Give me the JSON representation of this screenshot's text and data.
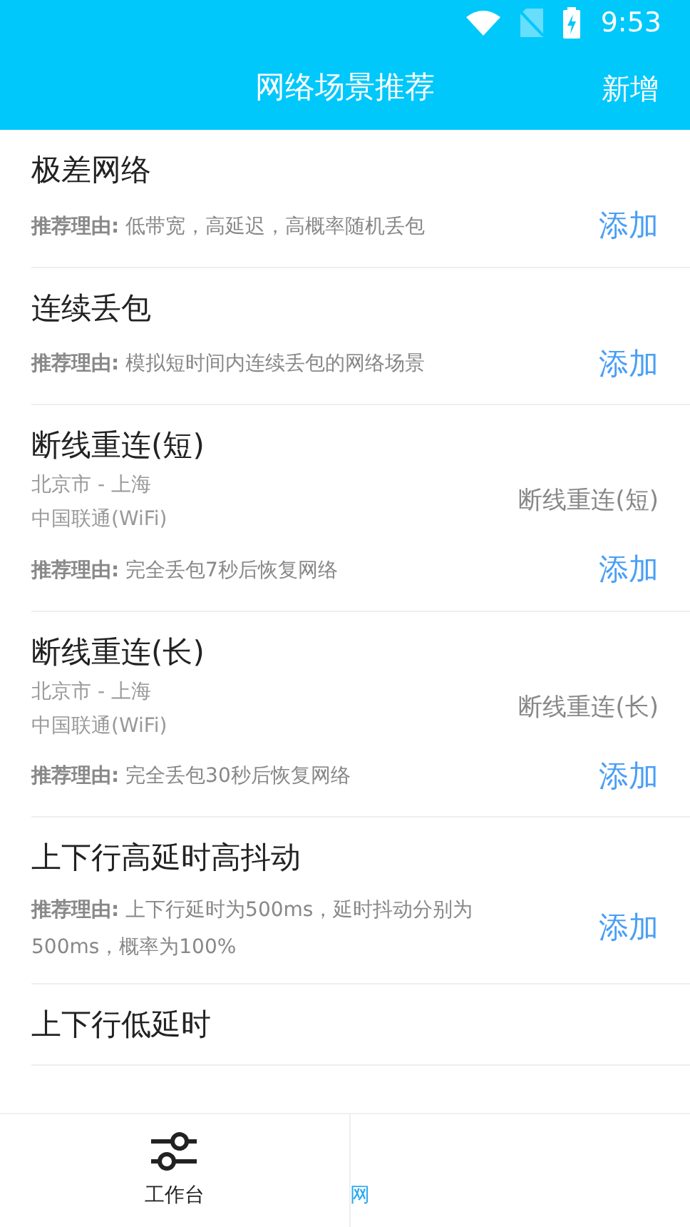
{
  "status_bar": {
    "time": "9:53"
  },
  "header": {
    "title": "网络场景推荐",
    "action": "新增"
  },
  "scenes": [
    {
      "title": "极差网络",
      "reason": "**推荐理由:** 低带宽，高延迟，高概率随机丢包",
      "action": "添加"
    },
    {
      "title": "连续丢包",
      "reason": "**推荐理由:** 模拟短时间内连续丢包的网络场景",
      "action": "添加"
    },
    {
      "title": "断线重连(短)",
      "route": "北京市 - 上海",
      "carrier": "中国联通(WiFi)",
      "tag": "断线重连(短)",
      "reason": "**推荐理由:** 完全丢包7秒后恢复网络",
      "action": "添加"
    },
    {
      "title": "断线重连(长)",
      "route": "北京市 - 上海",
      "carrier": "中国联通(WiFi)",
      "tag": "断线重连(长)",
      "reason": "**推荐理由:** 完全丢包30秒后恢复网络",
      "action": "添加"
    },
    {
      "title": "上下行高延时高抖动",
      "reason": "**推荐理由:** 上下行延时为500ms，延时抖动分别为500ms，概率为100%",
      "action": "添加"
    },
    {
      "title": "上下行低延时"
    }
  ],
  "bottom_nav": [
    {
      "kind": "workbench",
      "label": "工作台",
      "selected": false
    },
    {
      "kind": "network",
      "label": "网",
      "selected": true
    }
  ]
}
